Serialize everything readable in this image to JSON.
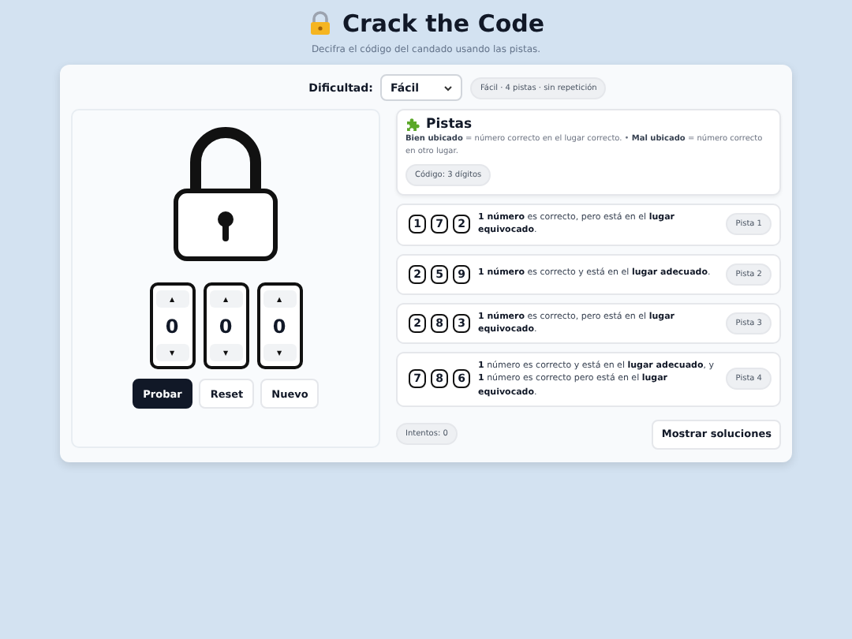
{
  "header": {
    "title": "Crack the Code",
    "subtitle": "Decifra el código del candado usando las pistas."
  },
  "difficulty": {
    "label": "Dificultad:",
    "value": "Fácil",
    "badge": "Fácil · 4 pistas · sin repetición"
  },
  "lock": {
    "dials": [
      {
        "value": "0",
        "up": "▲",
        "down": "▼"
      },
      {
        "value": "0",
        "up": "▲",
        "down": "▼"
      },
      {
        "value": "0",
        "up": "▲",
        "down": "▼"
      }
    ],
    "buttons": [
      {
        "label": "Probar",
        "kind": "primary"
      },
      {
        "label": "Reset",
        "kind": "secondary"
      },
      {
        "label": "Nuevo",
        "kind": "secondary"
      }
    ]
  },
  "clues": {
    "title": "Pistas",
    "legend": "**Bien ubicado** = número correcto en el lugar correcto.  •  **Mal ubicado** = número correcto en otro lugar.",
    "code_badge": "Código: 3 dígitos",
    "items": [
      {
        "digits": [
          "1",
          "7",
          "2"
        ],
        "text": "**1 número** es correcto, pero está en el **lugar equivocado**.",
        "label": "Pista 1"
      },
      {
        "digits": [
          "2",
          "5",
          "9"
        ],
        "text": "**1 número** es correcto y está en el **lugar adecuado**.",
        "label": "Pista 2"
      },
      {
        "digits": [
          "2",
          "8",
          "3"
        ],
        "text": "**1 número** es correcto, pero está en el **lugar equivocado**.",
        "label": "Pista 3"
      },
      {
        "digits": [
          "7",
          "8",
          "6"
        ],
        "text": "**1** número es correcto y está en el **lugar adecuado**, y **1** número es correcto pero está en el **lugar equivocado**.",
        "label": "Pista 4"
      }
    ]
  },
  "footer": {
    "attempts": "Intentos: 0",
    "show_button": "Mostrar soluciones"
  }
}
